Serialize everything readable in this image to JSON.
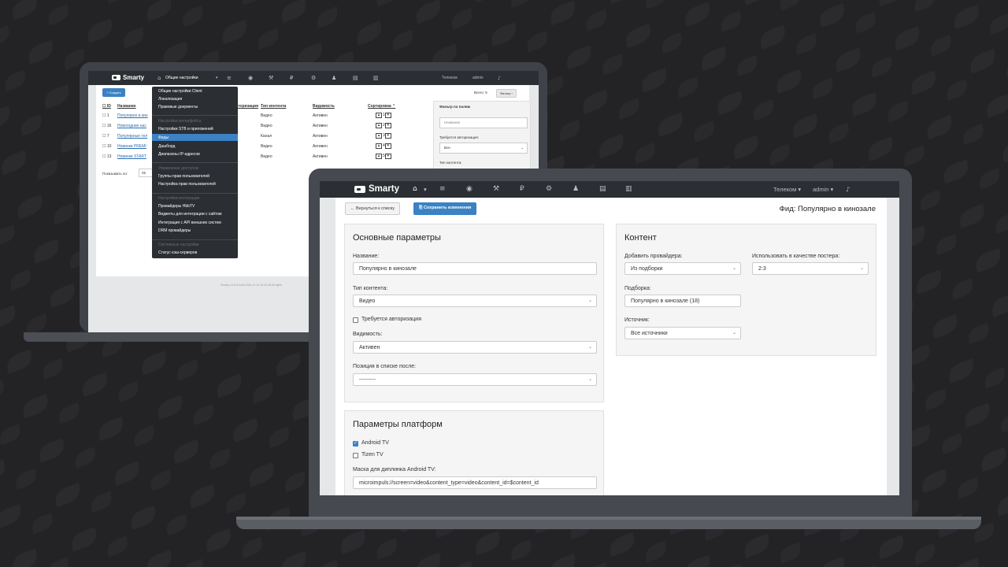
{
  "back_window": {
    "logo": "Smarty",
    "nav_menu_label": "Общие настройки",
    "nav_right": {
      "tenant": "Телеком",
      "user": "admin"
    },
    "create_button": "Создать",
    "total_label": "Всего: 5",
    "filter_button": "Фильтр",
    "table": {
      "headers": [
        "ID",
        "Название",
        "Авторизация",
        "Тип контента",
        "Видимость",
        "Сортировка"
      ],
      "rows": [
        {
          "id": "1",
          "name": "Популярно в кин",
          "type": "Видео",
          "visibility": "Активен",
          "sort": "1"
        },
        {
          "id": "16",
          "name": "Новогодние нас",
          "type": "Видео",
          "visibility": "Активен",
          "sort": "2"
        },
        {
          "id": "7",
          "name": "Популярные тел",
          "type": "Канал",
          "visibility": "Активен",
          "sort": "3"
        },
        {
          "id": "10",
          "name": "Новинки PREMI",
          "type": "Видео",
          "visibility": "Активен",
          "sort": "4"
        },
        {
          "id": "13",
          "name": "Новинки START",
          "type": "Видео",
          "visibility": "Активен",
          "sort": "5"
        }
      ]
    },
    "show_per_page_label": "Показывать по:",
    "show_per_page_value": "25",
    "filter_panel": {
      "title": "Фильтр по полям",
      "name_placeholder": "Название",
      "auth_label": "Требуется авторизация:",
      "auth_value": "Все",
      "content_type_label": "Тип контента:"
    },
    "footer": "Smarty v.2.6.4 build 2024-11-12 10:42:28   All rights",
    "dropdown": {
      "items": [
        {
          "text": "Общие настройки Client",
          "type": "item"
        },
        {
          "text": "Локализация",
          "type": "item"
        },
        {
          "text": "Правовые документы",
          "type": "item"
        },
        {
          "text": "Настройки интерфейса",
          "type": "header"
        },
        {
          "text": "Настройки STB и приложений",
          "type": "item"
        },
        {
          "text": "Фиды",
          "type": "active"
        },
        {
          "text": "Дашборд",
          "type": "item"
        },
        {
          "text": "Диапазоны IP-адресов",
          "type": "item"
        },
        {
          "text": "Управление доступом",
          "type": "header"
        },
        {
          "text": "Группы прав пользователей",
          "type": "item"
        },
        {
          "text": "Настройка прав пользователей",
          "type": "item"
        },
        {
          "text": "Настройки интеграции",
          "type": "header"
        },
        {
          "text": "Провайдеры HbbTV",
          "type": "item"
        },
        {
          "text": "Виджеты для интеграции с сайтом",
          "type": "item"
        },
        {
          "text": "Интеграция с API внешних систем",
          "type": "item"
        },
        {
          "text": "DRM провайдеры",
          "type": "item"
        },
        {
          "text": "Системные настройки",
          "type": "header"
        },
        {
          "text": "Статус кэш-серверов",
          "type": "item"
        }
      ]
    }
  },
  "front_window": {
    "logo": "Smarty",
    "nav_right": {
      "tenant": "Телеком",
      "user": "admin"
    },
    "back_button": "← Вернуться к списку",
    "save_button": "Сохранить изменения",
    "page_title": "Фид: Популярно в кинозале",
    "main_params": {
      "title": "Основные параметры",
      "name_label": "Название:",
      "name_value": "Популярно в кинозале",
      "content_type_label": "Тип контента:",
      "content_type_value": "Видео",
      "auth_required_label": "Требуется авторизация",
      "auth_required_checked": false,
      "visibility_label": "Видимость:",
      "visibility_value": "Активен",
      "position_label": "Позиция в списке после:",
      "position_value": "---------"
    },
    "content": {
      "title": "Контент",
      "add_provider_label": "Добавить провайдера:",
      "add_provider_value": "Из подборки",
      "poster_label": "Использовать в качестве постера:",
      "poster_value": "2:3",
      "collection_label": "Подборка:",
      "collection_value": "Популярно в кинозале (18)",
      "source_label": "Источник:",
      "source_value": "Все источники"
    },
    "platform_params": {
      "title": "Параметры платформ",
      "android_tv_label": "Android TV",
      "android_tv_checked": true,
      "tizen_tv_label": "Tizen TV",
      "tizen_tv_checked": false,
      "deeplink_label": "Маска для диплинка Android TV:",
      "deeplink_value": "microimpuls://screen=video&content_type=video&content_id=$content_id"
    }
  },
  "colors": {
    "background": "#232325",
    "navbar": "#2b2e33",
    "accent": "#3a82c4"
  }
}
